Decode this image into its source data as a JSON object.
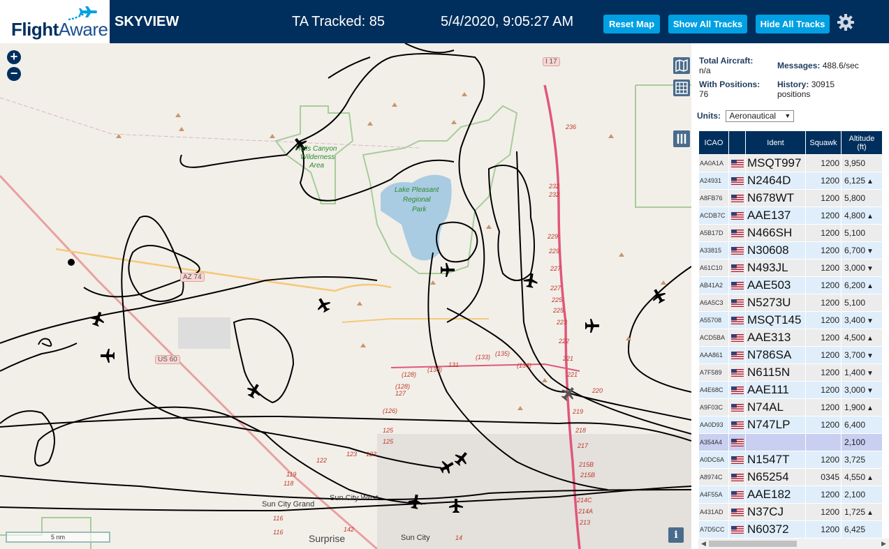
{
  "header": {
    "logo_flight": "Flight",
    "logo_aware": "Aware",
    "title": "SKYVIEW",
    "tracked": "TA Tracked: 85",
    "clock": "5/4/2020, 9:05:27 AM",
    "buttons": {
      "reset": "Reset Map",
      "show_all": "Show All Tracks",
      "hide_all": "Hide All Tracks"
    },
    "settings_icon": "gear-icon"
  },
  "map": {
    "zoom_in": "+",
    "zoom_out": "−",
    "scale": "5 nm",
    "info": "i",
    "labels": {
      "sun_city_grand": "Sun City Grand",
      "sun_city_west": "Sun City West",
      "sun_city": "Sun City",
      "surprise": "Surprise",
      "lake_pleasant": "Lake Pleasant",
      "regional": "Regional",
      "park": "Park",
      "hells_canyon": "Hells Canyon",
      "wilderness": "Wilderness",
      "area": "Area",
      "az74": "AZ 74",
      "us60": "US 60",
      "i17": "I 17"
    },
    "road_numbers": [
      "236",
      "232",
      "232",
      "229",
      "229",
      "227",
      "227",
      "225",
      "225",
      "223",
      "222",
      "221",
      "221",
      "220",
      "219",
      "218",
      "217",
      "215B",
      "215B",
      "214C",
      "214A",
      "213",
      "(135)",
      "(133)",
      "(136)",
      "(130)",
      "131",
      "(128)",
      "(128)",
      "127",
      "(126)",
      "125",
      "125",
      "123",
      "123",
      "122",
      "119",
      "118",
      "116",
      "116",
      "142",
      "14"
    ],
    "colors": {
      "track": "#000000",
      "header": "#002f5d",
      "button": "#00a0e2",
      "lake": "#a9cce3",
      "park_border": "#a8cc9a",
      "highway": "#e0577a"
    }
  },
  "panel": {
    "total_aircraft_label": "Total Aircraft:",
    "total_aircraft_value": "n/a",
    "with_positions_label": "With Positions:",
    "with_positions_value": "76",
    "messages_label": "Messages:",
    "messages_value": "488.6/sec",
    "history_label": "History:",
    "history_value": "30915",
    "history_unit": "positions",
    "units_label": "Units:",
    "units_value": "Aeronautical",
    "columns": {
      "icao": "ICAO",
      "ident": "Ident",
      "squawk": "Squawk",
      "altitude": "Altitude",
      "altitude_unit": "(ft)"
    },
    "rows": [
      {
        "icao": "AA0A1A",
        "ident": "MSQT997",
        "squawk": "1200",
        "alt": "3,950",
        "trend": ""
      },
      {
        "icao": "A24931",
        "ident": "N2464D",
        "squawk": "1200",
        "alt": "6,125",
        "trend": "▲"
      },
      {
        "icao": "A8FB76",
        "ident": "N678WT",
        "squawk": "1200",
        "alt": "5,800",
        "trend": ""
      },
      {
        "icao": "ACDB7C",
        "ident": "AAE137",
        "squawk": "1200",
        "alt": "4,800",
        "trend": "▲"
      },
      {
        "icao": "A5B17D",
        "ident": "N466SH",
        "squawk": "1200",
        "alt": "5,100",
        "trend": ""
      },
      {
        "icao": "A33815",
        "ident": "N30608",
        "squawk": "1200",
        "alt": "6,700",
        "trend": "▼"
      },
      {
        "icao": "A61C10",
        "ident": "N493JL",
        "squawk": "1200",
        "alt": "3,000",
        "trend": "▼"
      },
      {
        "icao": "AB41A2",
        "ident": "AAE503",
        "squawk": "1200",
        "alt": "6,200",
        "trend": "▲"
      },
      {
        "icao": "A6A5C3",
        "ident": "N5273U",
        "squawk": "1200",
        "alt": "5,100",
        "trend": ""
      },
      {
        "icao": "A55708",
        "ident": "MSQT145",
        "squawk": "1200",
        "alt": "3,400",
        "trend": "▼"
      },
      {
        "icao": "ACD5BA",
        "ident": "AAE313",
        "squawk": "1200",
        "alt": "4,500",
        "trend": "▲"
      },
      {
        "icao": "AAA861",
        "ident": "N786SA",
        "squawk": "1200",
        "alt": "3,700",
        "trend": "▼"
      },
      {
        "icao": "A7F589",
        "ident": "N6115N",
        "squawk": "1200",
        "alt": "1,400",
        "trend": "▼"
      },
      {
        "icao": "A4E68C",
        "ident": "AAE111",
        "squawk": "1200",
        "alt": "3,000",
        "trend": "▼"
      },
      {
        "icao": "A9F03C",
        "ident": "N74AL",
        "squawk": "1200",
        "alt": "1,900",
        "trend": "▲"
      },
      {
        "icao": "AA0D93",
        "ident": "N747LP",
        "squawk": "1200",
        "alt": "6,400",
        "trend": ""
      },
      {
        "icao": "A354A4",
        "ident": "",
        "squawk": "",
        "alt": "2,100",
        "trend": "",
        "selected": true
      },
      {
        "icao": "A0DC6A",
        "ident": "N1547T",
        "squawk": "1200",
        "alt": "3,725",
        "trend": ""
      },
      {
        "icao": "A8974C",
        "ident": "N65254",
        "squawk": "0345",
        "alt": "4,550",
        "trend": "▲"
      },
      {
        "icao": "A4F55A",
        "ident": "AAE182",
        "squawk": "1200",
        "alt": "2,100",
        "trend": ""
      },
      {
        "icao": "A431AD",
        "ident": "N37CJ",
        "squawk": "1200",
        "alt": "1,725",
        "trend": "▲"
      },
      {
        "icao": "A7D5CC",
        "ident": "N60372",
        "squawk": "1200",
        "alt": "6,425",
        "trend": ""
      }
    ],
    "scroll_left": "◀",
    "scroll_right": "▶"
  }
}
